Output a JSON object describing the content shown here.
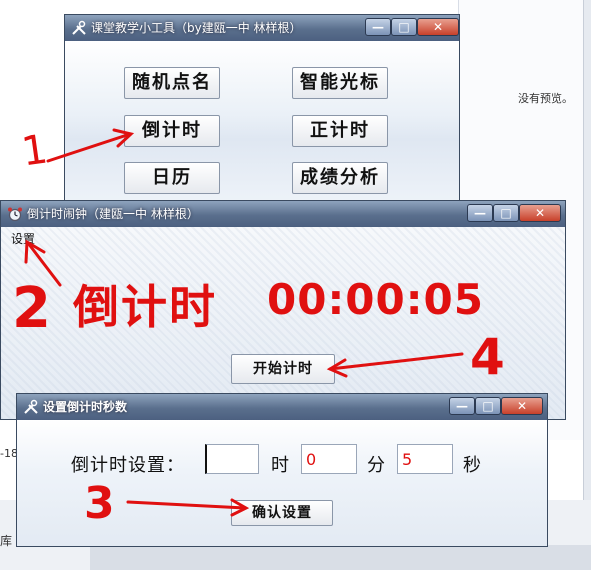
{
  "background": {
    "preview_text": "没有预览。",
    "left_text_1": "-18",
    "left_text_2": "库"
  },
  "tool_window": {
    "title": "课堂教学小工具（by建瓯一中 林样根）",
    "buttons": [
      "随机点名",
      "智能光标",
      "倒计时",
      "正计时",
      "日历",
      "成绩分析"
    ]
  },
  "countdown_window": {
    "title": "倒计时闹钟（建瓯一中 林样根）",
    "menu_settings": "设置",
    "label": "倒计时",
    "time": "00:00:05",
    "start_button": "开始计时"
  },
  "settings_window": {
    "title": "设置倒计时秒数",
    "label": "倒计时设置：",
    "hours_value": "",
    "hours_unit": "时",
    "minutes_value": "0",
    "minutes_unit": "分",
    "seconds_value": "5",
    "seconds_unit": "秒",
    "confirm_button": "确认设置"
  },
  "annotations": {
    "step1": "1",
    "step2": "2",
    "step3": "3",
    "step4": "4",
    "color": "#e01010"
  },
  "window_controls": {
    "minimize": "—",
    "maximize": "□",
    "close": "✕"
  }
}
